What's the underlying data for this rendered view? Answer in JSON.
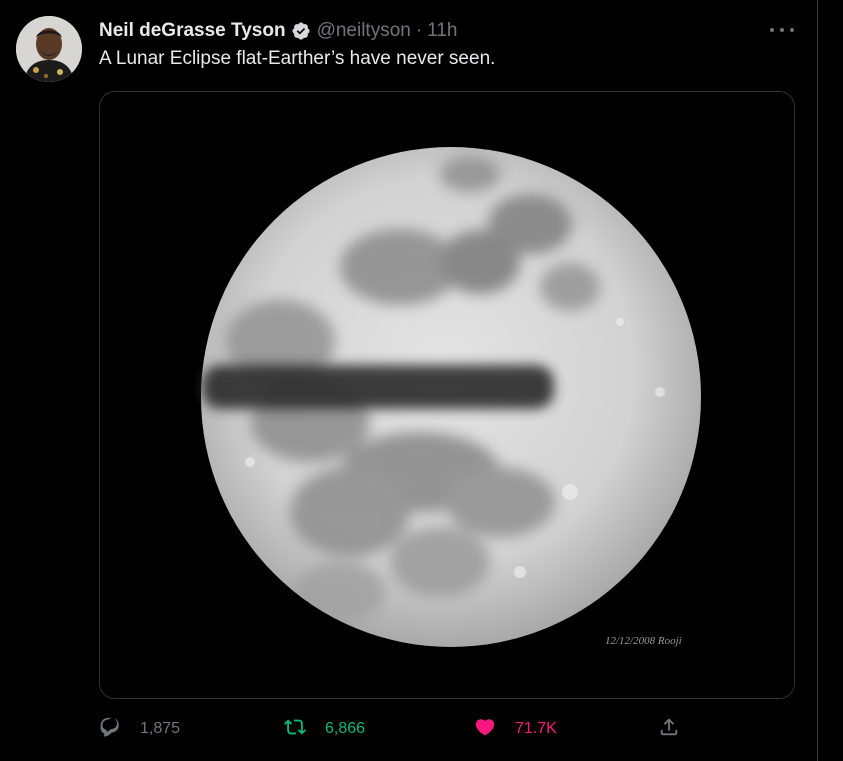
{
  "tweet": {
    "display_name": "Neil deGrasse Tyson",
    "handle": "@neiltyson",
    "separator": "·",
    "timestamp": "11h",
    "text": "A Lunar Eclipse flat-Earther’s have never seen.",
    "image_caption": "12/12/2008 Rooji",
    "verified": true
  },
  "actions": {
    "replies": "1,875",
    "retweets": "6,866",
    "likes": "71.7K"
  },
  "icons": {
    "verified": "verified-badge-icon",
    "more": "more-icon",
    "reply": "reply-icon",
    "retweet": "retweet-icon",
    "like": "heart-icon",
    "share": "share-icon"
  },
  "colors": {
    "background": "#000000",
    "text": "#e7e9ea",
    "secondary": "#71767b",
    "retweet_active": "#00ba7c",
    "like_active": "#f91880",
    "border": "#2f3336"
  }
}
